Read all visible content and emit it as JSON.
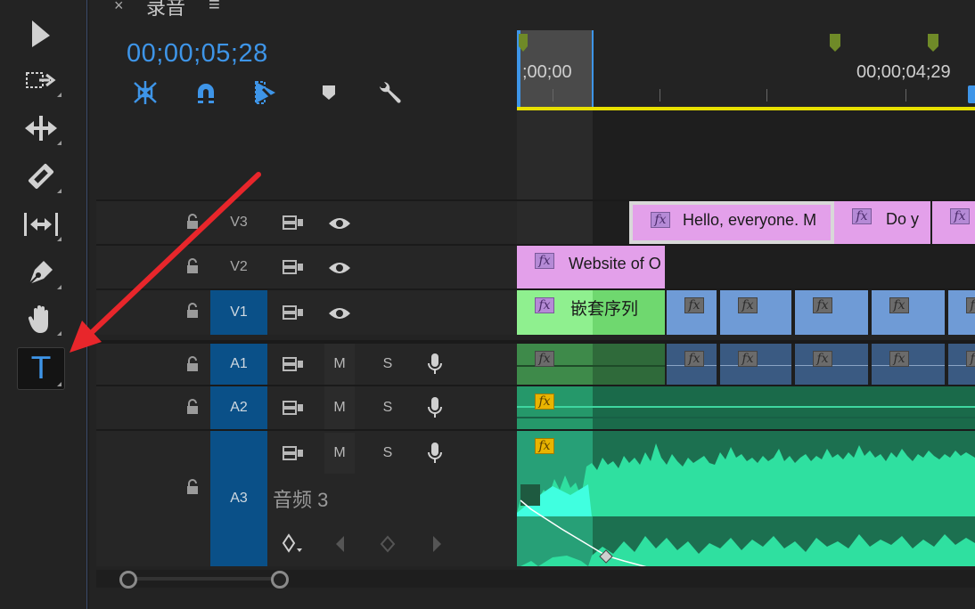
{
  "panel": {
    "close_glyph": "×",
    "title": "录音",
    "menu_glyph": "≡",
    "timecode": "00;00;05;28"
  },
  "toolbar": {
    "tools": [
      {
        "name": "selection-tool-icon"
      },
      {
        "name": "track-select-tool-icon"
      },
      {
        "name": "ripple-edit-tool-icon"
      },
      {
        "name": "razor-tool-icon"
      },
      {
        "name": "slip-tool-icon"
      },
      {
        "name": "pen-tool-icon"
      },
      {
        "name": "hand-tool-icon"
      },
      {
        "name": "type-tool-icon",
        "label": "T",
        "active": true
      }
    ]
  },
  "timeline_tools": [
    "nest-toggle-icon",
    "snap-magnet-icon",
    "linked-selection-icon",
    "add-marker-icon",
    "timeline-settings-wrench-icon"
  ],
  "ruler": {
    "start_time": ";00;00",
    "mark_time": "00;00;04;29"
  },
  "tracks": {
    "v3": {
      "name": "V3"
    },
    "v2": {
      "name": "V2"
    },
    "v1": {
      "name": "V1"
    },
    "a1": {
      "name": "A1",
      "mute": "M",
      "solo": "S"
    },
    "a2": {
      "name": "A2",
      "mute": "M",
      "solo": "S"
    },
    "a3": {
      "name": "A3",
      "mute": "M",
      "solo": "S",
      "label": "音频 3"
    }
  },
  "clips": {
    "v3_clip1": {
      "fx": "fx",
      "title": "Hello, everyone. M"
    },
    "v3_clip2": {
      "fx": "fx",
      "title": "Do y"
    },
    "v3_clip3": {
      "fx": "fx"
    },
    "v2_clip1": {
      "fx": "fx",
      "title": "Website of O"
    },
    "v1_nested": {
      "fx": "fx",
      "title": "嵌套序列"
    },
    "fx": "fx"
  },
  "colors": {
    "accent_blue": "#3e95e8",
    "title_clip": "#e3a0ea",
    "nested_clip": "#7ad97a",
    "video_clip": "#6f9bd6",
    "audio_clip": "#20a070",
    "waveform": "#2fe0a0",
    "work_area_bar": "#e8e000",
    "annotation_arrow": "#e8262b"
  }
}
